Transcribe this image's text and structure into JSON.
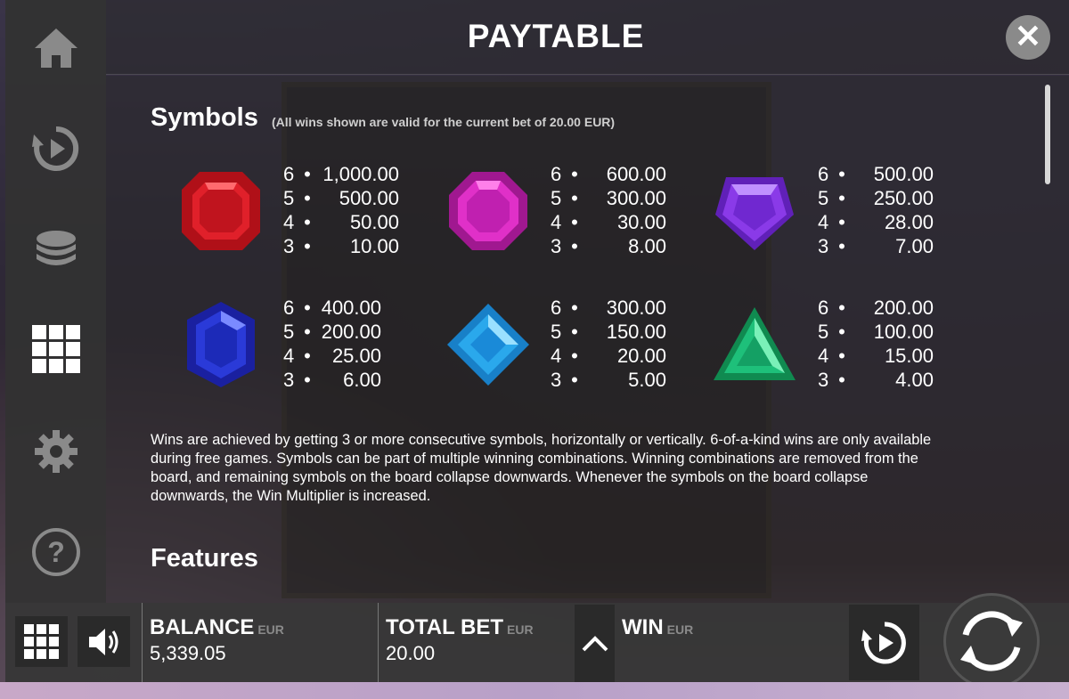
{
  "header": {
    "title": "PAYTABLE"
  },
  "nav": [
    {
      "icon": "home-icon"
    },
    {
      "icon": "replay-icon"
    },
    {
      "icon": "coins-icon"
    },
    {
      "icon": "paytable-grid-icon"
    },
    {
      "icon": "gear-icon"
    },
    {
      "icon": "help-icon"
    }
  ],
  "symbols_section": {
    "title": "Symbols",
    "note": "(All wins shown are valid for the current bet of 20.00 EUR)"
  },
  "symbols": [
    {
      "name": "red-gem-icon",
      "color": "#e0202a",
      "pays": [
        {
          "count": "6",
          "value": "1,000.00"
        },
        {
          "count": "5",
          "value": "500.00"
        },
        {
          "count": "4",
          "value": "50.00"
        },
        {
          "count": "3",
          "value": "10.00"
        }
      ]
    },
    {
      "name": "pink-gem-icon",
      "color": "#e030c8",
      "pays": [
        {
          "count": "6",
          "value": "600.00"
        },
        {
          "count": "5",
          "value": "300.00"
        },
        {
          "count": "4",
          "value": "30.00"
        },
        {
          "count": "3",
          "value": "8.00"
        }
      ]
    },
    {
      "name": "purple-gem-icon",
      "color": "#8a3ae8",
      "pays": [
        {
          "count": "6",
          "value": "500.00"
        },
        {
          "count": "5",
          "value": "250.00"
        },
        {
          "count": "4",
          "value": "28.00"
        },
        {
          "count": "3",
          "value": "7.00"
        }
      ]
    },
    {
      "name": "blue-gem-icon",
      "color": "#2a3ad8",
      "pays": [
        {
          "count": "6",
          "value": "400.00"
        },
        {
          "count": "5",
          "value": "200.00"
        },
        {
          "count": "4",
          "value": "25.00"
        },
        {
          "count": "3",
          "value": "6.00"
        }
      ]
    },
    {
      "name": "cyan-gem-icon",
      "color": "#2aa8ec",
      "pays": [
        {
          "count": "6",
          "value": "300.00"
        },
        {
          "count": "5",
          "value": "150.00"
        },
        {
          "count": "4",
          "value": "20.00"
        },
        {
          "count": "3",
          "value": "5.00"
        }
      ]
    },
    {
      "name": "green-gem-icon",
      "color": "#1ec07a",
      "pays": [
        {
          "count": "6",
          "value": "200.00"
        },
        {
          "count": "5",
          "value": "100.00"
        },
        {
          "count": "4",
          "value": "15.00"
        },
        {
          "count": "3",
          "value": "4.00"
        }
      ]
    }
  ],
  "description": "Wins are achieved by getting 3 or more consecutive symbols, horizontally or vertically. 6-of-a-kind wins are only available during free games. Symbols can be part of multiple winning combinations. Winning combinations are removed from the board, and remaining symbols on the board collapse downwards. Whenever the symbols on the board collapse downwards, the Win Multiplier is increased.",
  "features_section": {
    "title": "Features"
  },
  "bottom": {
    "balance_label": "BALANCE",
    "balance_unit": "EUR",
    "balance_value": "5,339.05",
    "bet_label": "TOTAL BET",
    "bet_unit": "EUR",
    "bet_value": "20.00",
    "win_label": "WIN",
    "win_unit": "EUR"
  }
}
